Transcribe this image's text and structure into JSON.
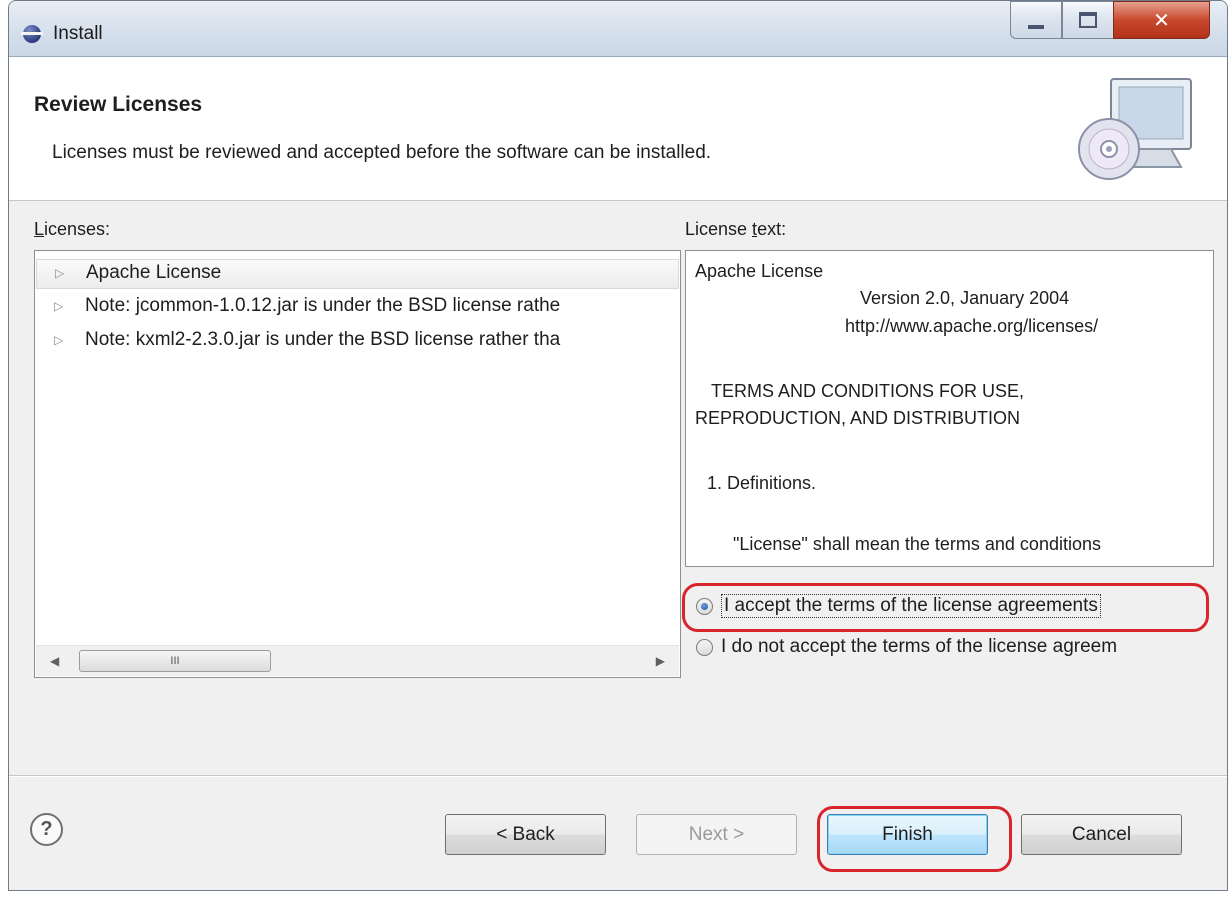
{
  "window": {
    "title": "Install"
  },
  "banner": {
    "title": "Review Licenses",
    "description": "Licenses must be reviewed and accepted before the software can be installed."
  },
  "licenses_panel": {
    "label": "Licenses:",
    "items": [
      {
        "label": "Apache License",
        "selected": true
      },
      {
        "label": "Note:  jcommon-1.0.12.jar is under the BSD license rathe",
        "selected": false
      },
      {
        "label": "Note:  kxml2-2.3.0.jar is under the BSD license rather tha",
        "selected": false
      }
    ],
    "scrollbar_thumb_grip": "III"
  },
  "license_text_panel": {
    "label": "License text:",
    "lines": [
      "Apache License",
      "Version 2.0, January 2004",
      "http://www.apache.org/licenses/",
      "TERMS AND CONDITIONS FOR USE,",
      "REPRODUCTION, AND DISTRIBUTION",
      "1. Definitions.",
      "\"License\" shall mean the terms and conditions"
    ]
  },
  "acceptance": {
    "accept_label": "I accept the terms of the license agreements",
    "decline_label": "I do not accept the terms of the license agreem",
    "selected": "accept"
  },
  "buttons": {
    "back": "< Back",
    "next": "Next >",
    "finish": "Finish",
    "cancel": "Cancel"
  },
  "colors": {
    "highlight": "#d8252b",
    "title_bar": "#d6e0ec",
    "close_button": "#c9492e"
  }
}
